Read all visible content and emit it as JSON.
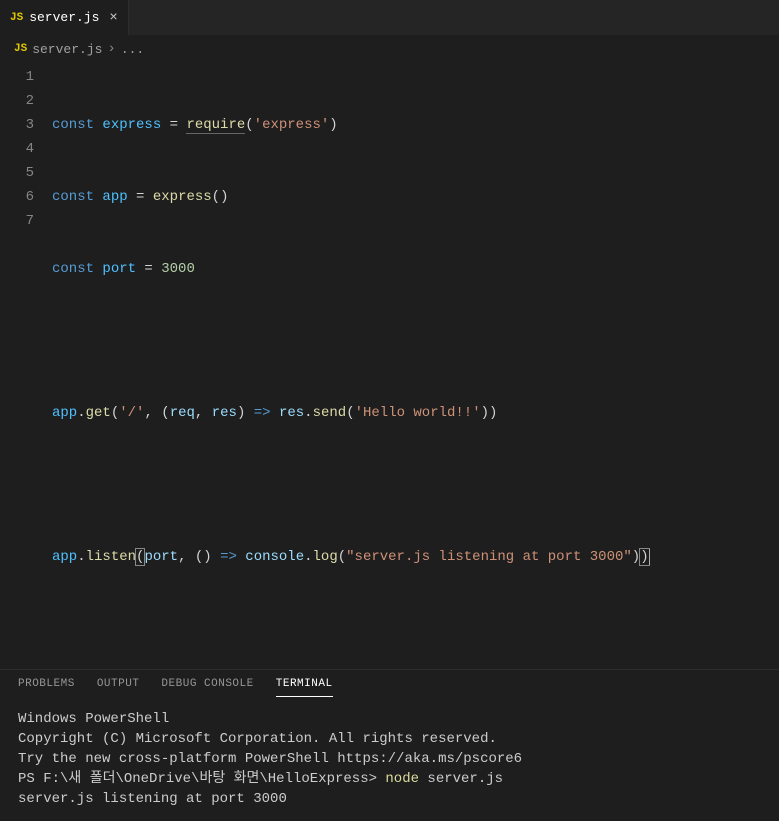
{
  "tab": {
    "icon": "JS",
    "label": "server.js",
    "close": "×"
  },
  "breadcrumb": {
    "icon": "JS",
    "file": "server.js",
    "sep": "›",
    "ellipsis": "..."
  },
  "lines": {
    "l1": "1",
    "l2": "2",
    "l3": "3",
    "l4": "4",
    "l5": "5",
    "l6": "6",
    "l7": "7"
  },
  "code": {
    "const": "const",
    "express": "express",
    "app": "app",
    "port": "port",
    "require": "require",
    "eq": " = ",
    "lparen": "(",
    "rparen": ")",
    "comma": ", ",
    "dot": ".",
    "arrow": " => ",
    "sq_express": "'express'",
    "num3000": "3000",
    "get": "get",
    "listen": "listen",
    "send": "send",
    "log": "log",
    "console": "console",
    "req": "req",
    "res": "res",
    "sq_slash": "'/'",
    "sq_hello": "'Hello world!!'",
    "dq_listen": "\"server.js listening at port 3000\"",
    "empty_parens": "()"
  },
  "panel": {
    "problems": "PROBLEMS",
    "output": "OUTPUT",
    "debug": "DEBUG CONSOLE",
    "terminal": "TERMINAL"
  },
  "terminal": {
    "l1": "Windows PowerShell",
    "l2": "Copyright (C) Microsoft Corporation. All rights reserved.",
    "l3": "",
    "l4": "Try the new cross-platform PowerShell https://aka.ms/pscore6",
    "l5": "",
    "prompt": "PS F:\\새 폴더\\OneDrive\\바탕 화면\\HelloExpress> ",
    "cmd1": "node ",
    "cmd2": "server.js",
    "l7": "server.js listening at port 3000"
  }
}
